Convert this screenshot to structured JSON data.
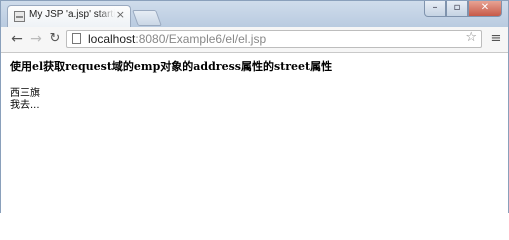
{
  "tab": {
    "title": "My JSP 'a.jsp' starting page",
    "close_glyph": "×"
  },
  "window_controls": {
    "minimize": "–",
    "maximize": "▫",
    "close": "✕"
  },
  "toolbar": {
    "back_glyph": "←",
    "forward_glyph": "→",
    "reload_glyph": "↻",
    "url_host": "localhost",
    "url_path": ":8080/Example6/el/el.jsp",
    "star_glyph": "☆",
    "menu_glyph": "≡"
  },
  "page": {
    "heading": "使用el获取request域的emp对象的address属性的street属性",
    "line1": "西三旗",
    "line2": "我去..."
  },
  "icons": {
    "favicon": "page-favicon-icon",
    "page": "page-info-icon",
    "star": "bookmark-star-icon",
    "menu": "hamburger-menu-icon"
  }
}
